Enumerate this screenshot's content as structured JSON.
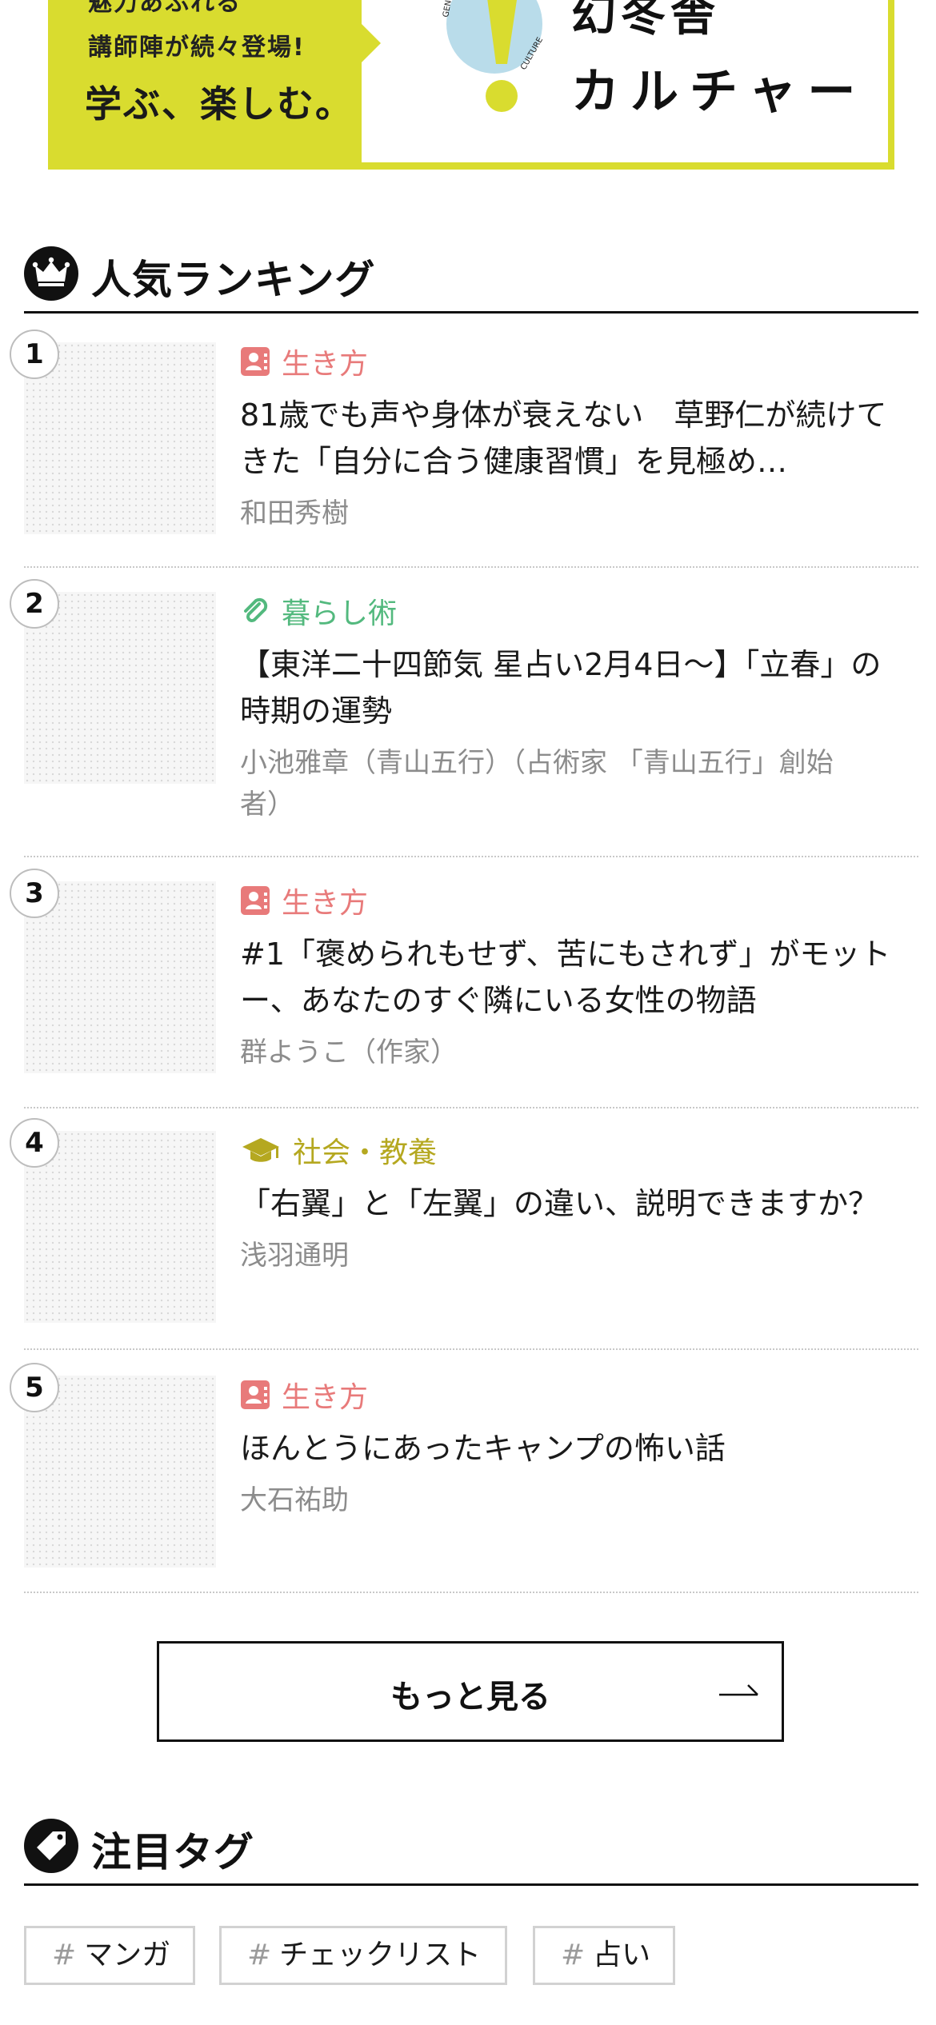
{
  "banner": {
    "line1": "魅力あふれる",
    "line2": "講師陣が続々登場!",
    "line3": "学ぶ、楽しむ。",
    "logo_ring_top": "GENTO",
    "logo_ring_right": "CULTURE",
    "title_line1": "幻冬舎",
    "title_line2": "カルチャー",
    "colors": {
      "accent": "#d9dc2f",
      "logo_blue": "#b9dcea"
    }
  },
  "ranking": {
    "heading": "人気ランキング",
    "heading_icon": "crown-icon",
    "items": [
      {
        "rank": "1",
        "category": "生き方",
        "category_icon": "contact-card-icon",
        "title_lines": [
          "81歳でも声や身体が衰えない　草野仁が続けて",
          "きた「自分に合う健康習慣」を見極め…"
        ],
        "author_lines": [
          "和田秀樹"
        ]
      },
      {
        "rank": "2",
        "category": "暮らし術",
        "category_icon": "paperclip-icon",
        "title_lines": [
          "【東洋二十四節気 星占い2月4日〜】「立春」の",
          "時期の運勢"
        ],
        "author_lines": [
          "小池雅章（青山五行）（占術家 「青山五行」創始",
          "者）"
        ]
      },
      {
        "rank": "3",
        "category": "生き方",
        "category_icon": "contact-card-icon",
        "title_lines": [
          "#1「褒められもせず、苦にもされず」がモット",
          "ー、あなたのすぐ隣にいる女性の物語"
        ],
        "author_lines": [
          "群ようこ（作家）"
        ]
      },
      {
        "rank": "4",
        "category": "社会・教養",
        "category_icon": "graduation-cap-icon",
        "title_lines": [
          "「右翼」と「左翼」の違い、説明できますか？"
        ],
        "author_lines": [
          "浅羽通明"
        ]
      },
      {
        "rank": "5",
        "category": "生き方",
        "category_icon": "contact-card-icon",
        "title_lines": [
          "ほんとうにあったキャンプの怖い話"
        ],
        "author_lines": [
          "大石祐助"
        ]
      }
    ],
    "more_button": "もっと見る",
    "more_icon": "long-arrow-right-icon"
  },
  "tags_section": {
    "heading": "注目タグ",
    "heading_icon": "tag-icon",
    "hash": "#",
    "tags": [
      "マンガ",
      "チェックリスト",
      "占い"
    ]
  },
  "colors": {
    "category_life": "#e87a7a",
    "category_living": "#53b97e",
    "category_society": "#b5a820",
    "author_gray": "#8c8c8c"
  }
}
